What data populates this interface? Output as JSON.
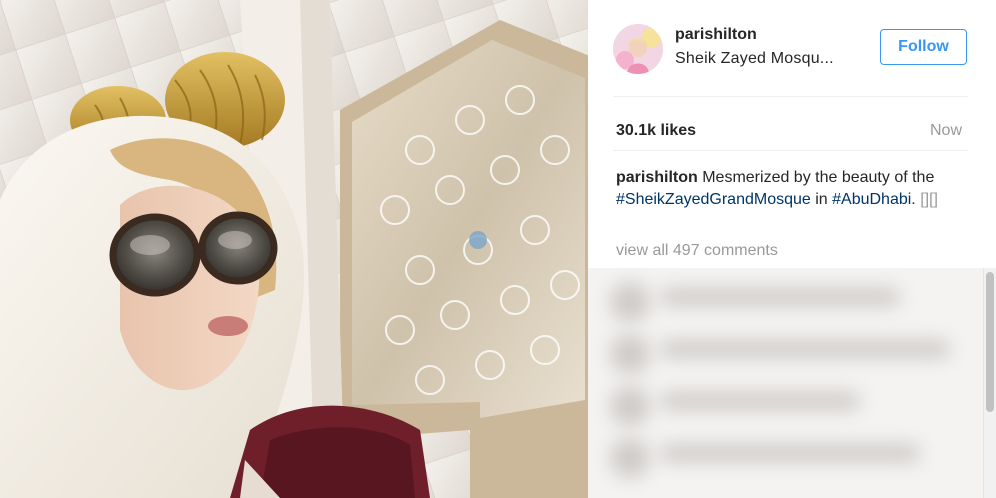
{
  "post": {
    "username": "parishilton",
    "location": "Sheik Zayed Mosqu...",
    "follow_label": "Follow",
    "likes": "30.1k likes",
    "time": "Now",
    "caption": {
      "user": "parishilton",
      "text_1": " Mesmerized by the beauty of the ",
      "hashtag_1": "#SheikZayedGrandMosque",
      "text_2": " in ",
      "hashtag_2": "#AbuDhabi",
      "text_3": ". ",
      "emoji": "[][]"
    },
    "view_all": "view all 497 comments"
  },
  "colors": {
    "link_blue": "#3897f0",
    "hashtag": "#003569",
    "muted": "#999999",
    "text": "#262626"
  },
  "icons": {
    "avatar": "profile-photo",
    "photo": "selfie-photo"
  }
}
